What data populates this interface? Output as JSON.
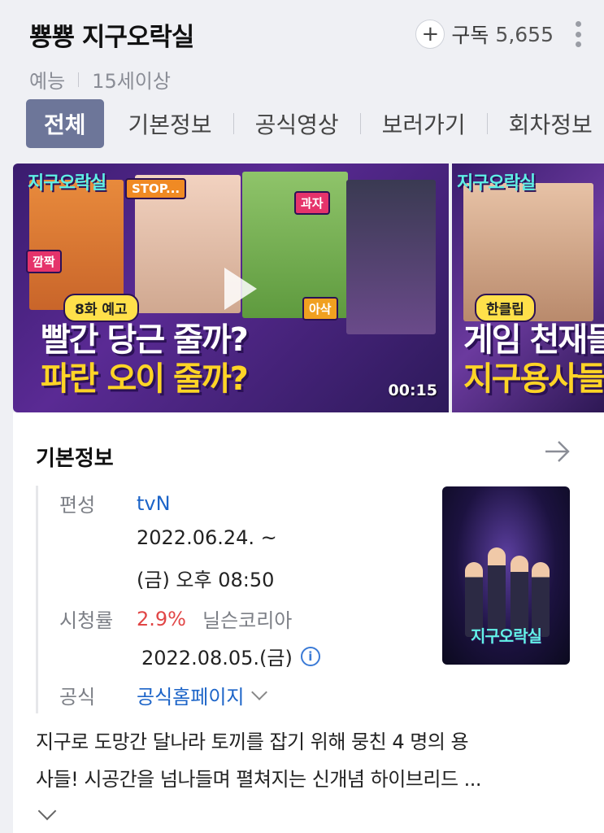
{
  "header": {
    "title": "뿅뿅 지구오락실",
    "genre": "예능",
    "rating": "15세이상",
    "subscribe_label": "구독",
    "subscribe_count": "5,655"
  },
  "tabs": [
    {
      "label": "전체",
      "active": true
    },
    {
      "label": "기본정보",
      "active": false
    },
    {
      "label": "공식영상",
      "active": false
    },
    {
      "label": "보러가기",
      "active": false
    },
    {
      "label": "회차정보",
      "active": false
    }
  ],
  "videos": [
    {
      "logo": "지구오락실",
      "badge": "8화 예고",
      "caption_line1": "빨간 당근 줄까?",
      "caption_line2": "파란 오이 줄까?",
      "tags": [
        "STOP...",
        "과자",
        "깜짝",
        "아삭"
      ],
      "duration": "00:15"
    },
    {
      "logo": "지구오락실",
      "badge": "한클립",
      "caption_line1": "게임 천재들",
      "caption_line2": "지구용사들"
    }
  ],
  "info": {
    "section_title": "기본정보",
    "broadcaster_label": "편성",
    "broadcaster": "tvN",
    "air_dates": "2022.06.24. ~",
    "air_time": "(금) 오후 08:50",
    "ratings_label": "시청률",
    "ratings_value": "2.9%",
    "ratings_source": "닐슨코리아",
    "ratings_date": "2022.08.05.(금)",
    "official_label": "공식",
    "official_link": "공식홈페이지",
    "poster_title": "지구오락실",
    "description_line1": "지구로 도망간 달나라 토끼를 잡기 위해 뭉친 4 명의 용",
    "description_line2": "사들! 시공간을 넘나들며 펼쳐지는 신개념 하이브리드 ..."
  },
  "colors": {
    "active_tab": "#6d7699",
    "link": "#1c64c8",
    "rating": "#e14646",
    "background": "#eff0f4"
  }
}
